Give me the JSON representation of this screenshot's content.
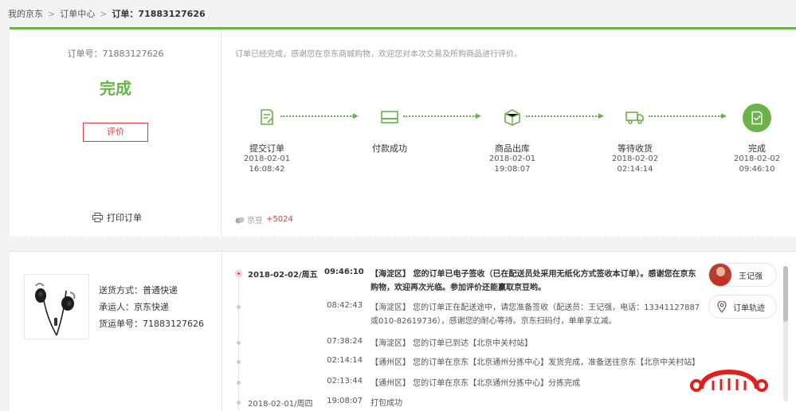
{
  "breadcrumb": {
    "home": "我的京东",
    "center": "订单中心",
    "current": "订单：71883127626"
  },
  "order": {
    "number_label": "订单号：71883127626",
    "status": "完成",
    "evaluate_label": "评价",
    "print_label": "打印订单",
    "notice": "订单已经完成，感谢您在京东商城购物，欢迎您对本次交易及所购商品进行评价。"
  },
  "progress": {
    "steps": [
      {
        "label": "提交订单",
        "date": "2018-02-01",
        "time": "16:08:42",
        "icon": "order-submit-icon"
      },
      {
        "label": "付款成功",
        "date": "",
        "time": "",
        "icon": "payment-card-icon"
      },
      {
        "label": "商品出库",
        "date": "2018-02-01",
        "time": "19:08:07",
        "icon": "package-out-icon"
      },
      {
        "label": "等待收货",
        "date": "2018-02-02",
        "time": "02:14:14",
        "icon": "delivery-truck-icon"
      },
      {
        "label": "完成",
        "date": "2018-02-02",
        "time": "09:46:10",
        "icon": "completed-check-icon"
      }
    ]
  },
  "bean": {
    "label": "京豆",
    "value": "+5024"
  },
  "shipping": {
    "method": "送货方式：普通快递",
    "carrier": "承运人：京东快递",
    "tracking_no": "货运单号：71883127626"
  },
  "tracking": [
    {
      "date": "2018-02-02/周五",
      "time": "09:46:10",
      "text": "【海淀区】 您的订单已电子签收（已在配送员处采用无纸化方式签收本订单）。感谢您在京东购物，欢迎再次光临。参加评价还能赢取京豆哟。"
    },
    {
      "date": "",
      "time": "08:42:43",
      "text": "【海淀区】 您的订单正在配送途中，请您准备签收（配送员：王记强，电话：13341127887或010-82619736），感谢您的耐心等待。京东扫码付，单单享立减。"
    },
    {
      "date": "",
      "time": "07:38:24",
      "text": "【海淀区】 您的订单已到达【北京中关村站】"
    },
    {
      "date": "",
      "time": "02:14:14",
      "text": "【通州区】 您的订单在京东【北京通州分拣中心】发货完成，准备送往京东【北京中关村站】"
    },
    {
      "date": "",
      "time": "02:13:44",
      "text": "【通州区】 您的订单在京东【北京通州分拣中心】分拣完成"
    },
    {
      "date": "2018-02-01/周四",
      "time": "19:08:07",
      "text": "打包成功"
    }
  ],
  "courier": {
    "name": "王记强"
  },
  "track_button": "订单轨迹",
  "colors": {
    "accent_green": "#6bb24a",
    "accent_red": "#e4393c"
  }
}
